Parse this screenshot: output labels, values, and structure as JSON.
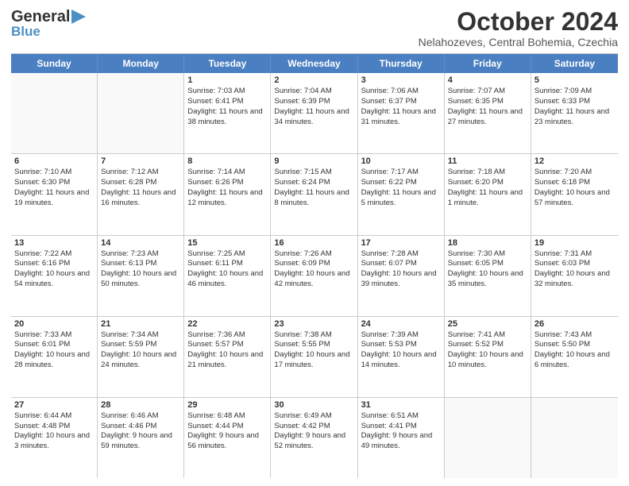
{
  "header": {
    "logo_general": "General",
    "logo_blue": "Blue",
    "logo_triangle": "▶",
    "month_title": "October 2024",
    "location": "Nelahozeves, Central Bohemia, Czechia"
  },
  "days_of_week": [
    "Sunday",
    "Monday",
    "Tuesday",
    "Wednesday",
    "Thursday",
    "Friday",
    "Saturday"
  ],
  "weeks": [
    [
      {
        "day": "",
        "sunrise": "",
        "sunset": "",
        "daylight": ""
      },
      {
        "day": "",
        "sunrise": "",
        "sunset": "",
        "daylight": ""
      },
      {
        "day": "1",
        "sunrise": "Sunrise: 7:03 AM",
        "sunset": "Sunset: 6:41 PM",
        "daylight": "Daylight: 11 hours and 38 minutes."
      },
      {
        "day": "2",
        "sunrise": "Sunrise: 7:04 AM",
        "sunset": "Sunset: 6:39 PM",
        "daylight": "Daylight: 11 hours and 34 minutes."
      },
      {
        "day": "3",
        "sunrise": "Sunrise: 7:06 AM",
        "sunset": "Sunset: 6:37 PM",
        "daylight": "Daylight: 11 hours and 31 minutes."
      },
      {
        "day": "4",
        "sunrise": "Sunrise: 7:07 AM",
        "sunset": "Sunset: 6:35 PM",
        "daylight": "Daylight: 11 hours and 27 minutes."
      },
      {
        "day": "5",
        "sunrise": "Sunrise: 7:09 AM",
        "sunset": "Sunset: 6:33 PM",
        "daylight": "Daylight: 11 hours and 23 minutes."
      }
    ],
    [
      {
        "day": "6",
        "sunrise": "Sunrise: 7:10 AM",
        "sunset": "Sunset: 6:30 PM",
        "daylight": "Daylight: 11 hours and 19 minutes."
      },
      {
        "day": "7",
        "sunrise": "Sunrise: 7:12 AM",
        "sunset": "Sunset: 6:28 PM",
        "daylight": "Daylight: 11 hours and 16 minutes."
      },
      {
        "day": "8",
        "sunrise": "Sunrise: 7:14 AM",
        "sunset": "Sunset: 6:26 PM",
        "daylight": "Daylight: 11 hours and 12 minutes."
      },
      {
        "day": "9",
        "sunrise": "Sunrise: 7:15 AM",
        "sunset": "Sunset: 6:24 PM",
        "daylight": "Daylight: 11 hours and 8 minutes."
      },
      {
        "day": "10",
        "sunrise": "Sunrise: 7:17 AM",
        "sunset": "Sunset: 6:22 PM",
        "daylight": "Daylight: 11 hours and 5 minutes."
      },
      {
        "day": "11",
        "sunrise": "Sunrise: 7:18 AM",
        "sunset": "Sunset: 6:20 PM",
        "daylight": "Daylight: 11 hours and 1 minute."
      },
      {
        "day": "12",
        "sunrise": "Sunrise: 7:20 AM",
        "sunset": "Sunset: 6:18 PM",
        "daylight": "Daylight: 10 hours and 57 minutes."
      }
    ],
    [
      {
        "day": "13",
        "sunrise": "Sunrise: 7:22 AM",
        "sunset": "Sunset: 6:16 PM",
        "daylight": "Daylight: 10 hours and 54 minutes."
      },
      {
        "day": "14",
        "sunrise": "Sunrise: 7:23 AM",
        "sunset": "Sunset: 6:13 PM",
        "daylight": "Daylight: 10 hours and 50 minutes."
      },
      {
        "day": "15",
        "sunrise": "Sunrise: 7:25 AM",
        "sunset": "Sunset: 6:11 PM",
        "daylight": "Daylight: 10 hours and 46 minutes."
      },
      {
        "day": "16",
        "sunrise": "Sunrise: 7:26 AM",
        "sunset": "Sunset: 6:09 PM",
        "daylight": "Daylight: 10 hours and 42 minutes."
      },
      {
        "day": "17",
        "sunrise": "Sunrise: 7:28 AM",
        "sunset": "Sunset: 6:07 PM",
        "daylight": "Daylight: 10 hours and 39 minutes."
      },
      {
        "day": "18",
        "sunrise": "Sunrise: 7:30 AM",
        "sunset": "Sunset: 6:05 PM",
        "daylight": "Daylight: 10 hours and 35 minutes."
      },
      {
        "day": "19",
        "sunrise": "Sunrise: 7:31 AM",
        "sunset": "Sunset: 6:03 PM",
        "daylight": "Daylight: 10 hours and 32 minutes."
      }
    ],
    [
      {
        "day": "20",
        "sunrise": "Sunrise: 7:33 AM",
        "sunset": "Sunset: 6:01 PM",
        "daylight": "Daylight: 10 hours and 28 minutes."
      },
      {
        "day": "21",
        "sunrise": "Sunrise: 7:34 AM",
        "sunset": "Sunset: 5:59 PM",
        "daylight": "Daylight: 10 hours and 24 minutes."
      },
      {
        "day": "22",
        "sunrise": "Sunrise: 7:36 AM",
        "sunset": "Sunset: 5:57 PM",
        "daylight": "Daylight: 10 hours and 21 minutes."
      },
      {
        "day": "23",
        "sunrise": "Sunrise: 7:38 AM",
        "sunset": "Sunset: 5:55 PM",
        "daylight": "Daylight: 10 hours and 17 minutes."
      },
      {
        "day": "24",
        "sunrise": "Sunrise: 7:39 AM",
        "sunset": "Sunset: 5:53 PM",
        "daylight": "Daylight: 10 hours and 14 minutes."
      },
      {
        "day": "25",
        "sunrise": "Sunrise: 7:41 AM",
        "sunset": "Sunset: 5:52 PM",
        "daylight": "Daylight: 10 hours and 10 minutes."
      },
      {
        "day": "26",
        "sunrise": "Sunrise: 7:43 AM",
        "sunset": "Sunset: 5:50 PM",
        "daylight": "Daylight: 10 hours and 6 minutes."
      }
    ],
    [
      {
        "day": "27",
        "sunrise": "Sunrise: 6:44 AM",
        "sunset": "Sunset: 4:48 PM",
        "daylight": "Daylight: 10 hours and 3 minutes."
      },
      {
        "day": "28",
        "sunrise": "Sunrise: 6:46 AM",
        "sunset": "Sunset: 4:46 PM",
        "daylight": "Daylight: 9 hours and 59 minutes."
      },
      {
        "day": "29",
        "sunrise": "Sunrise: 6:48 AM",
        "sunset": "Sunset: 4:44 PM",
        "daylight": "Daylight: 9 hours and 56 minutes."
      },
      {
        "day": "30",
        "sunrise": "Sunrise: 6:49 AM",
        "sunset": "Sunset: 4:42 PM",
        "daylight": "Daylight: 9 hours and 52 minutes."
      },
      {
        "day": "31",
        "sunrise": "Sunrise: 6:51 AM",
        "sunset": "Sunset: 4:41 PM",
        "daylight": "Daylight: 9 hours and 49 minutes."
      },
      {
        "day": "",
        "sunrise": "",
        "sunset": "",
        "daylight": ""
      },
      {
        "day": "",
        "sunrise": "",
        "sunset": "",
        "daylight": ""
      }
    ]
  ]
}
